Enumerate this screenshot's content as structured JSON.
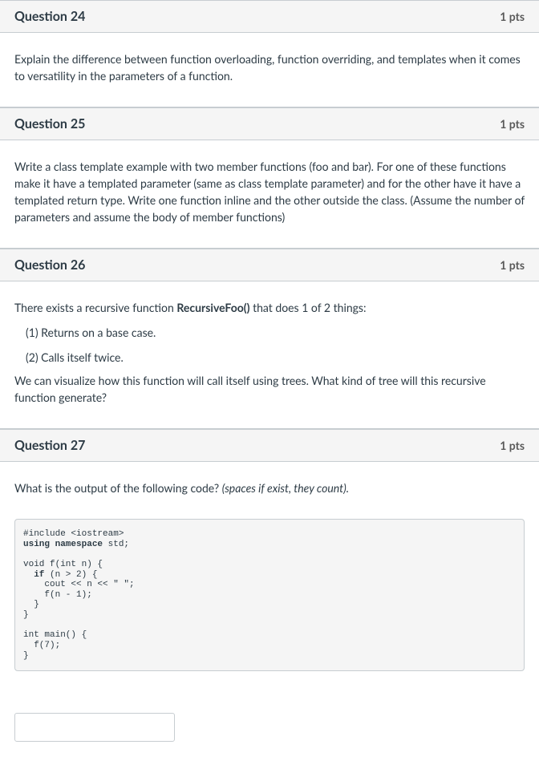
{
  "questions": [
    {
      "title": "Question 24",
      "points": "1 pts",
      "body_plain": "Explain the difference between function overloading, function overriding, and templates when it comes to versatility in the parameters of a function."
    },
    {
      "title": "Question 25",
      "points": "1 pts",
      "body_plain": "Write a class template example with two member functions (foo and bar). For one of these functions make it have a templated parameter (same as class template parameter) and for the other have it have a templated return type. Write one function inline and the other outside the class. (Assume the number of parameters and assume the body of member functions)"
    },
    {
      "title": "Question 26",
      "points": "1 pts",
      "intro_pre": "There exists a recursive function ",
      "bold": "RecursiveFoo()",
      "intro_post": " that does 1 of 2 things:",
      "item1": "(1) Returns on a base case.",
      "item2": "(2) Calls itself twice.",
      "closing": "We can visualize how this function will call itself using trees. What kind of tree will this recursive function generate?"
    },
    {
      "title": "Question 27",
      "points": "1 pts",
      "prompt_pre": "What is the output of the following code? ",
      "prompt_em": "(spaces if exist, they count).",
      "code": {
        "l1": "#include <iostream>",
        "l2a": "using namespace",
        "l2b": " std;",
        "l3": "void f(int n) {",
        "l4a": "  if",
        "l4b": " (n > 2) {",
        "l5": "    cout << n << \" \";",
        "l6": "    f(n - 1);",
        "l7": "  }",
        "l8": "}",
        "l9": "int main() {",
        "l10": "  f(7);",
        "l11": "}"
      },
      "answer_value": ""
    }
  ]
}
